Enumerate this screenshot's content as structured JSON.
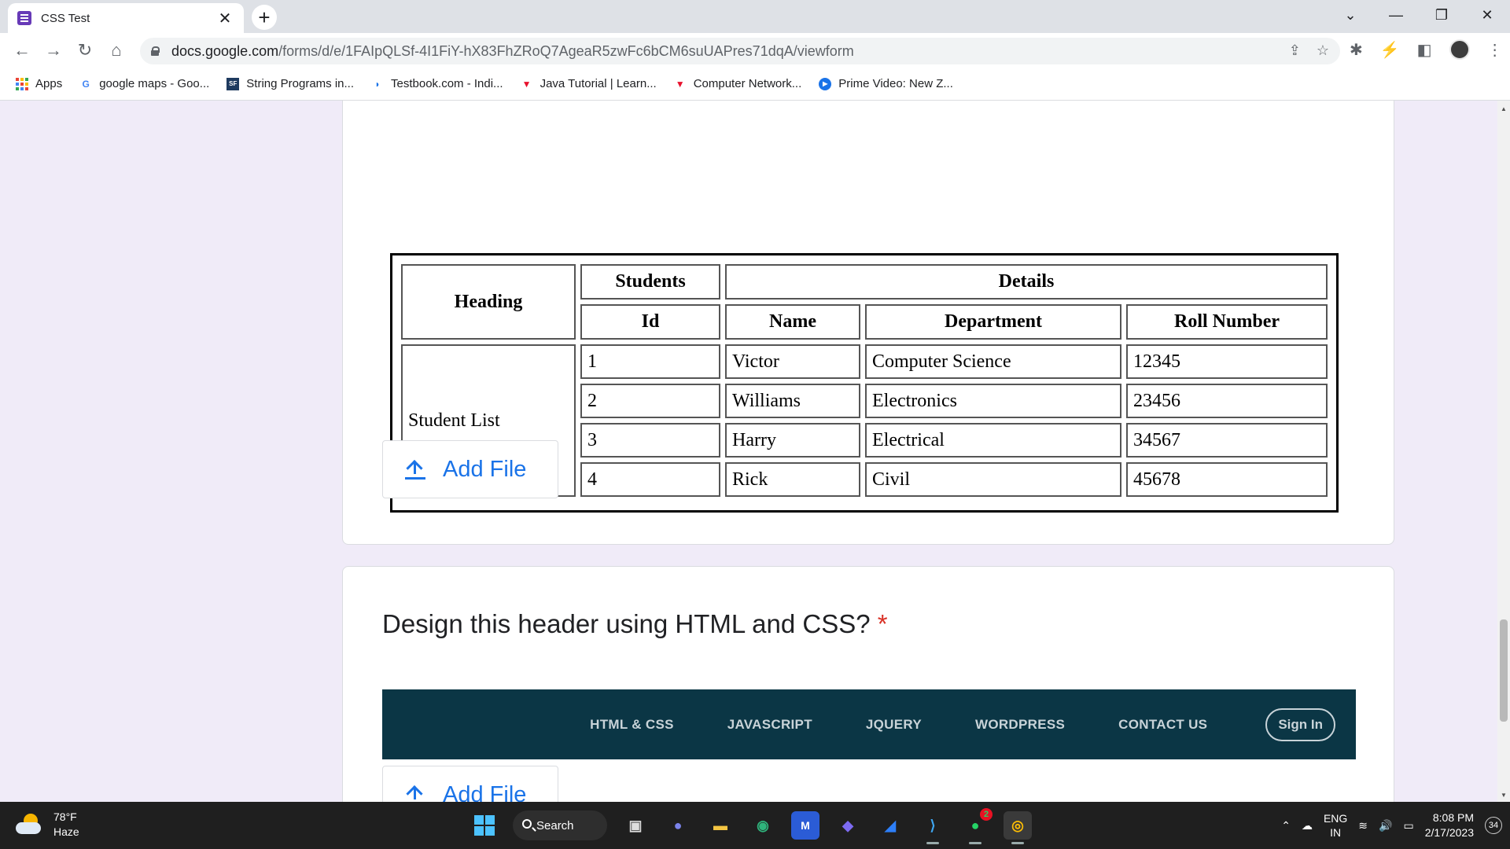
{
  "browser": {
    "tab_title": "CSS Test",
    "url_host": "docs.google.com",
    "url_path": "/forms/d/e/1FAIpQLSf-4I1FiY-hX83FhZRoQ7AgeaR5zwFc6bCM6suUAPres71dqA/viewform",
    "bookmarks": [
      {
        "label": "Apps",
        "icon": "apps-grid-icon"
      },
      {
        "label": "google maps - Goo...",
        "icon": "google-icon"
      },
      {
        "label": "String Programs in...",
        "icon": "sf-icon"
      },
      {
        "label": "Testbook.com - Indi...",
        "icon": "testbook-icon"
      },
      {
        "label": "Java Tutorial | Learn...",
        "icon": "v-logo-icon"
      },
      {
        "label": "Computer Network...",
        "icon": "v-logo-icon"
      },
      {
        "label": "Prime Video: New Z...",
        "icon": "prime-video-icon"
      }
    ]
  },
  "form": {
    "table_image": {
      "heading": "Heading",
      "students": "Students",
      "details": "Details",
      "col_id": "Id",
      "col_name": "Name",
      "col_department": "Department",
      "col_roll": "Roll Number",
      "row_label": "Student List",
      "rows": [
        {
          "id": "1",
          "name": "Victor",
          "department": "Computer Science",
          "roll": "12345"
        },
        {
          "id": "2",
          "name": "Williams",
          "department": "Electronics",
          "roll": "23456"
        },
        {
          "id": "3",
          "name": "Harry",
          "department": "Electrical",
          "roll": "34567"
        },
        {
          "id": "4",
          "name": "Rick",
          "department": "Civil",
          "roll": "45678"
        }
      ]
    },
    "add_file_label": "Add File",
    "question2": {
      "title": "Design this header using HTML and CSS?",
      "required_mark": "*",
      "header_nav": [
        "HTML & CSS",
        "JAVASCRIPT",
        "JQUERY",
        "WORDPRESS",
        "CONTACT US"
      ],
      "header_signin": "Sign In"
    }
  },
  "taskbar": {
    "temperature": "78°F",
    "condition": "Haze",
    "search_label": "Search",
    "whatsapp_badge": "2",
    "lang_top": "ENG",
    "lang_bottom": "IN",
    "time": "8:08 PM",
    "date": "2/17/2023",
    "notifications": "34"
  },
  "colors": {
    "form_bg": "#f0ebf8",
    "accent_blue": "#1a73e8",
    "required_red": "#d93025",
    "header_bg": "#0b3645"
  }
}
